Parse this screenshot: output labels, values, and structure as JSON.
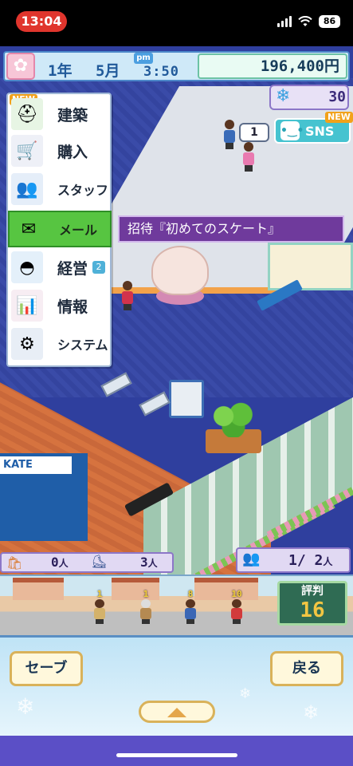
{
  "status_bar": {
    "time": "13:04",
    "battery": "86"
  },
  "hud": {
    "year": "1年",
    "month": "5月",
    "ampm": "pm",
    "clock": "3:50",
    "money": "196,400円",
    "season_value": "30",
    "sns_label": "SNS",
    "sns_new": "NEW",
    "bubble_count": "1"
  },
  "menu": {
    "new_badge": "NEW",
    "items": [
      {
        "label": "建築",
        "icon": "construction-worker-icon"
      },
      {
        "label": "購入",
        "icon": "shopping-cart-icon"
      },
      {
        "label": "スタッフ",
        "icon": "staff-people-icon"
      },
      {
        "label": "メール",
        "icon": "mail-icon",
        "active": true
      },
      {
        "label": "経営",
        "icon": "stadium-icon",
        "badge": "2"
      },
      {
        "label": "情報",
        "icon": "bar-chart-icon"
      },
      {
        "label": "システム",
        "icon": "gear-icon"
      }
    ]
  },
  "mail_tooltip": "招待『初めてのスケート』",
  "store_sign": "KATE",
  "counts": {
    "bag_count": "0",
    "skate_count": "3",
    "unit": "人",
    "visitors": "1/ 2"
  },
  "street": {
    "walker_levels": [
      "1",
      "1",
      "8",
      "10"
    ]
  },
  "reputation": {
    "label": "評判",
    "value": "16"
  },
  "buttons": {
    "save": "セーブ",
    "back": "戻る"
  }
}
